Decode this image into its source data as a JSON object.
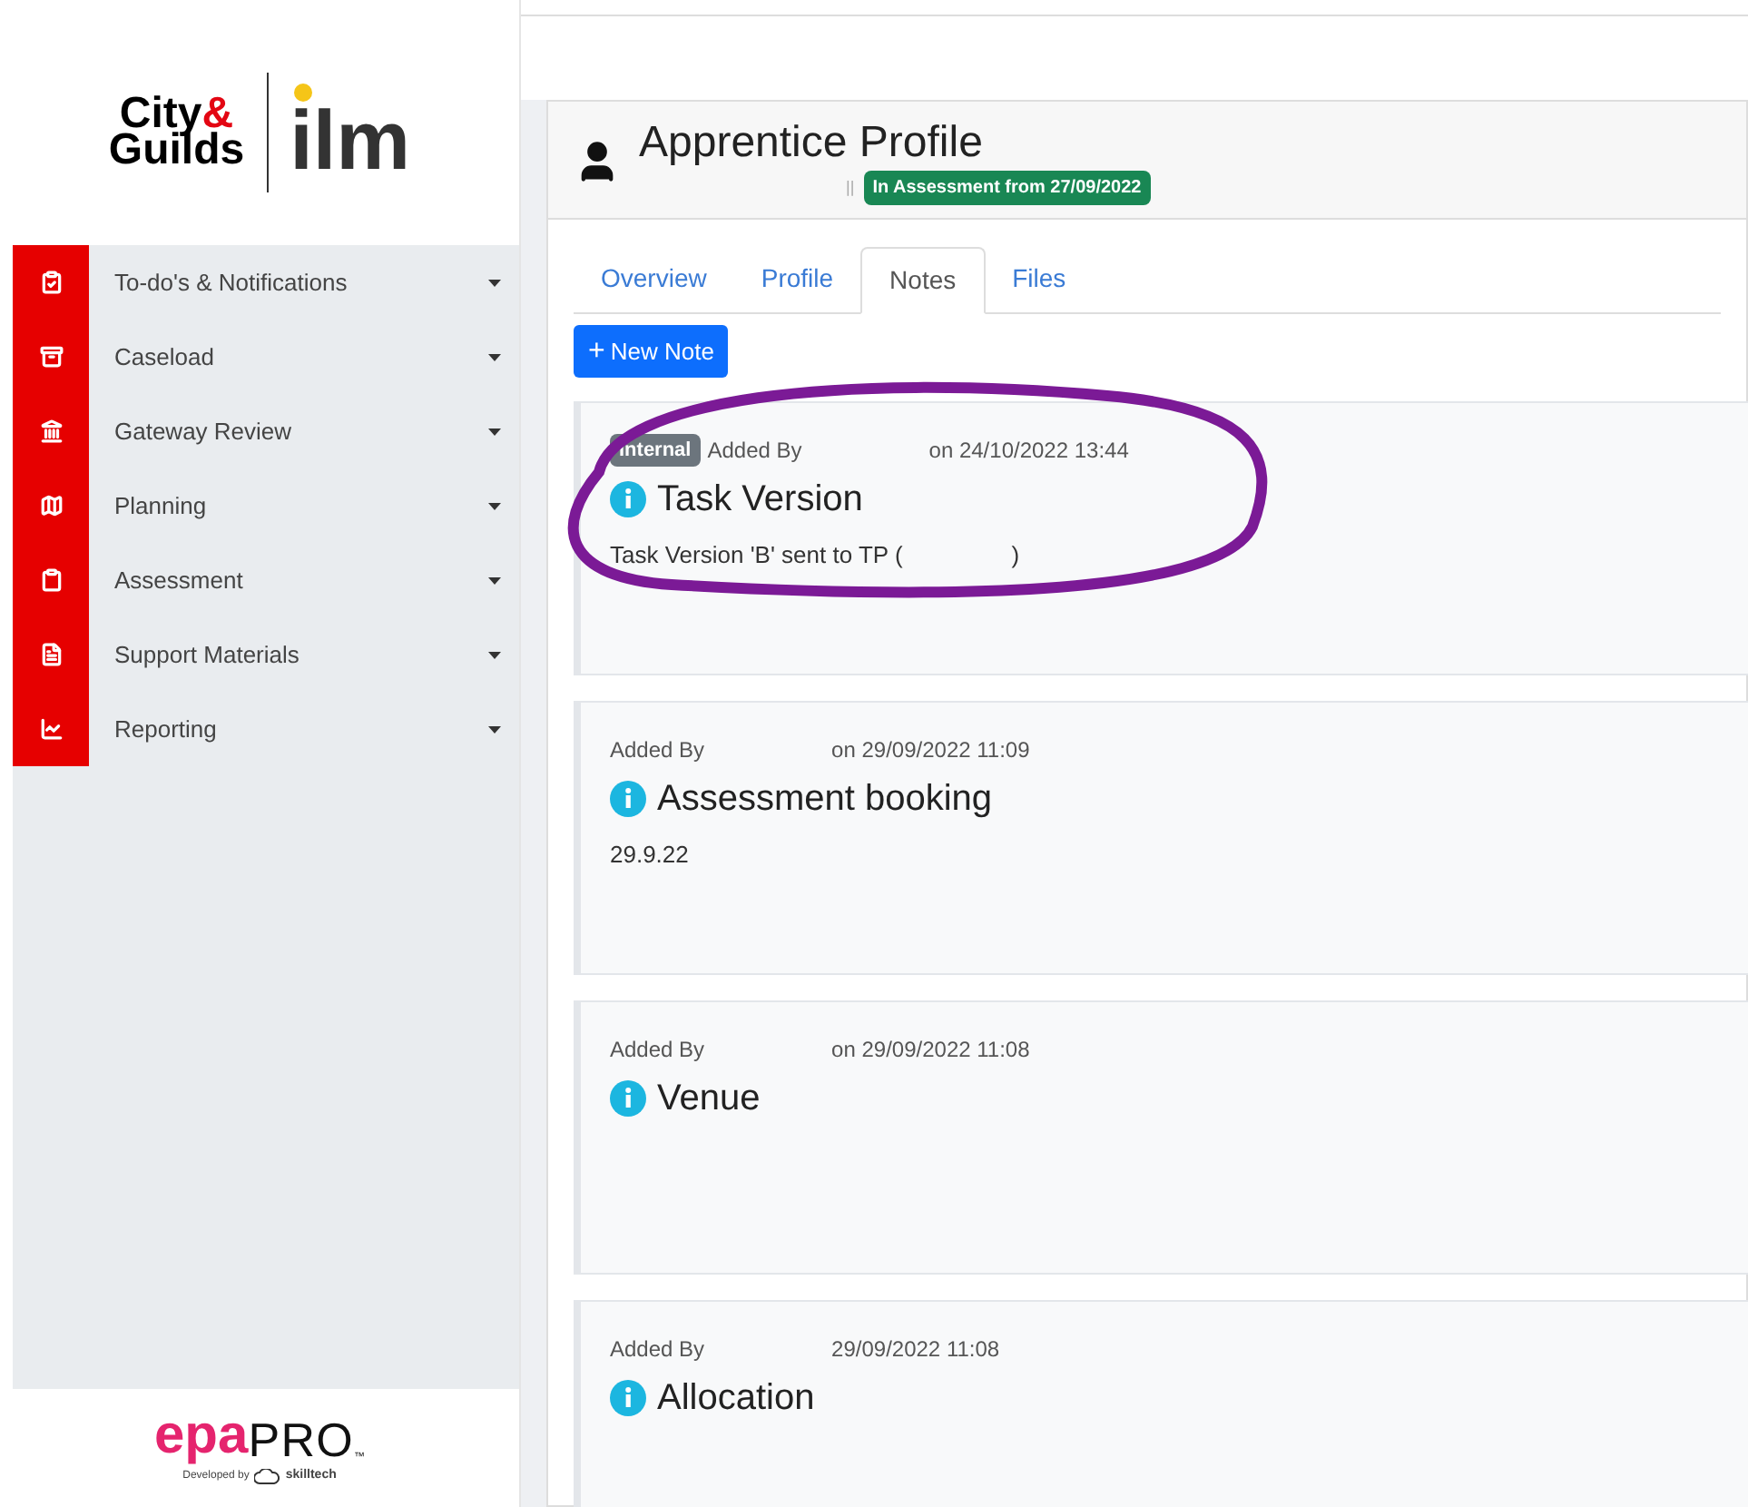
{
  "sidebar": {
    "logo": {
      "city": "City",
      "amp": "&",
      "guilds": "Guilds",
      "ilm": "ilm"
    },
    "items": [
      {
        "label": "To-do's & Notifications"
      },
      {
        "label": "Caseload"
      },
      {
        "label": "Gateway Review"
      },
      {
        "label": "Planning"
      },
      {
        "label": "Assessment"
      },
      {
        "label": "Support Materials"
      },
      {
        "label": "Reporting"
      }
    ],
    "footer": {
      "brand_a": "epa",
      "brand_b": "PRO",
      "tm": "™",
      "developed_by": "Developed by",
      "developer": "skilltech"
    }
  },
  "profile": {
    "title": "Apprentice Profile",
    "separator": "||",
    "status": "In Assessment from 27/09/2022"
  },
  "tabs": [
    {
      "label": "Overview",
      "selected": false
    },
    {
      "label": "Profile",
      "selected": false
    },
    {
      "label": "Notes",
      "selected": true
    },
    {
      "label": "Files",
      "selected": false
    }
  ],
  "new_note_button": {
    "icon": "+",
    "label": "New Note"
  },
  "notes": [
    {
      "tag": "Internal",
      "added_by": "Added By",
      "timestamp": "on 24/10/2022 13:44",
      "title": "Task Version",
      "body": "Task Version 'B' sent to TP (",
      "body_end": ")",
      "circled": true
    },
    {
      "added_by": "Added By",
      "timestamp": "on 29/09/2022 11:09",
      "title": "Assessment booking",
      "body": "29.9.22",
      "circled": false
    },
    {
      "added_by": "Added By",
      "timestamp": "on 29/09/2022 11:08",
      "title": "Venue",
      "circled": false
    },
    {
      "added_by": "Added By",
      "timestamp": "29/09/2022 11:08",
      "title": "Allocation",
      "circled": false
    }
  ]
}
